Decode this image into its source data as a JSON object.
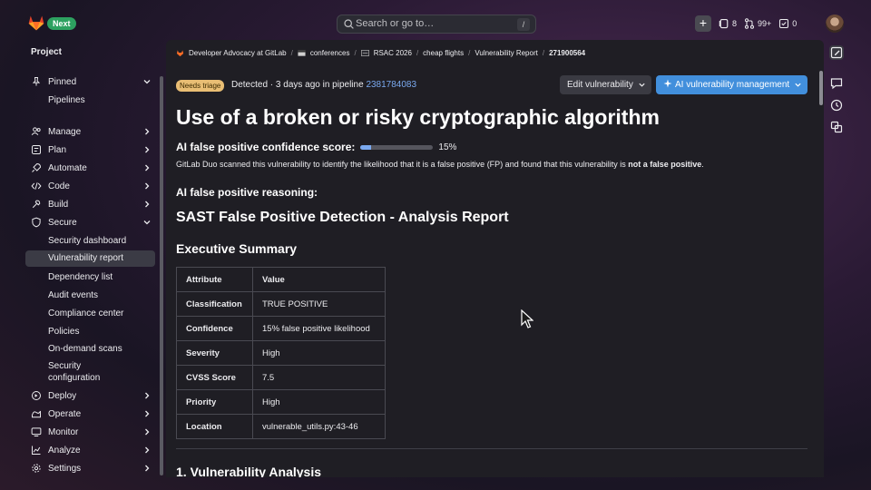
{
  "topbar": {
    "next_badge": "Next",
    "search_placeholder": "Search or go to…",
    "search_shortcut": "/",
    "issues_count": "8",
    "mr_count": "99+",
    "todo_count": "0"
  },
  "sidebar": {
    "title": "Project",
    "items": [
      {
        "label": "Pinned",
        "icon": "pin-icon",
        "chevron": "down"
      },
      {
        "label": "Manage",
        "icon": "users-icon",
        "chevron": "right"
      },
      {
        "label": "Plan",
        "icon": "plan-icon",
        "chevron": "right"
      },
      {
        "label": "Automate",
        "icon": "rocket-icon",
        "chevron": "right"
      },
      {
        "label": "Code",
        "icon": "code-icon",
        "chevron": "right"
      },
      {
        "label": "Build",
        "icon": "build-icon",
        "chevron": "right"
      },
      {
        "label": "Secure",
        "icon": "shield-icon",
        "chevron": "down"
      },
      {
        "label": "Deploy",
        "icon": "deploy-icon",
        "chevron": "right"
      },
      {
        "label": "Operate",
        "icon": "operate-icon",
        "chevron": "right"
      },
      {
        "label": "Monitor",
        "icon": "monitor-icon",
        "chevron": "right"
      },
      {
        "label": "Analyze",
        "icon": "chart-icon",
        "chevron": "right"
      },
      {
        "label": "Settings",
        "icon": "gear-icon",
        "chevron": "right"
      }
    ],
    "pinned_sub": [
      "Pipelines"
    ],
    "secure_sub": [
      "Security dashboard",
      "Vulnerability report",
      "Dependency list",
      "Audit events",
      "Compliance center",
      "Policies",
      "On-demand scans",
      "Security configuration"
    ]
  },
  "breadcrumb": [
    "Developer Advocacy at GitLab",
    "conferences",
    "RSAC 2026",
    "cheap flights",
    "Vulnerability Report",
    "271900564"
  ],
  "status": {
    "badge": "Needs triage",
    "detected_text": "Detected · 3 days ago in pipeline ",
    "pipeline_id": "2381784083"
  },
  "actions": {
    "edit_label": "Edit vulnerability",
    "ai_label": "AI vulnerability management"
  },
  "content": {
    "title": "Use of a broken or risky cryptographic algorithm",
    "score_label": "AI false positive confidence score:",
    "score_percent": 15,
    "score_text": "15%",
    "scan_text_pre": "GitLab Duo scanned this vulnerability to identify the likelihood that it is a false positive (FP) and found that this vulnerability is ",
    "scan_text_bold": "not a false positive",
    "scan_text_post": ".",
    "reasoning_heading": "AI false positive reasoning:",
    "report_heading": "SAST False Positive Detection - Analysis Report",
    "exec_heading": "Executive Summary",
    "table_headers": [
      "Attribute",
      "Value"
    ],
    "table_rows": [
      [
        "Classification",
        "TRUE POSITIVE"
      ],
      [
        "Confidence",
        "15% false positive likelihood"
      ],
      [
        "Severity",
        "High"
      ],
      [
        "CVSS Score",
        "7.5"
      ],
      [
        "Priority",
        "High"
      ],
      [
        "Location",
        "vulnerable_utils.py:43-46"
      ]
    ],
    "next_heading": "1. Vulnerability Analysis"
  },
  "colors": {
    "accent_blue": "#428fdc",
    "triage_badge": "#e9be74",
    "next_badge": "#2da160"
  }
}
